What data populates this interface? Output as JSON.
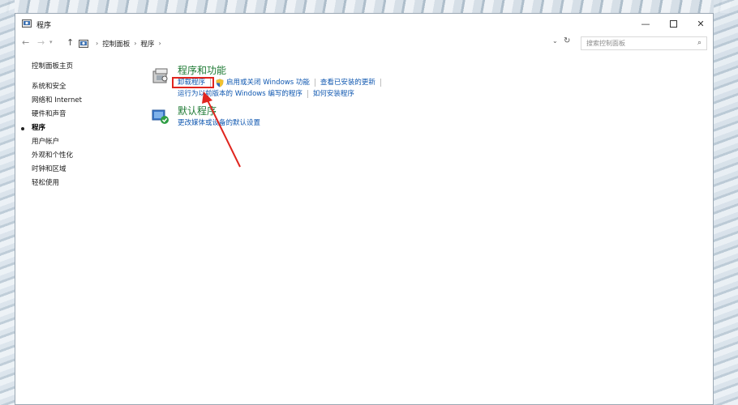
{
  "window": {
    "title": "程序",
    "controls": {
      "minimize": "—",
      "maximize": "",
      "close": "✕"
    }
  },
  "addressbar": {
    "crumbs": [
      "控制面板",
      "程序"
    ],
    "search_placeholder": "搜索控制面板"
  },
  "sidebar": {
    "home": "控制面板主页",
    "items": [
      {
        "label": "系统和安全"
      },
      {
        "label": "网络和 Internet"
      },
      {
        "label": "硬件和声音"
      },
      {
        "label": "程序",
        "current": true
      },
      {
        "label": "用户帐户"
      },
      {
        "label": "外观和个性化"
      },
      {
        "label": "时钟和区域"
      },
      {
        "label": "轻松使用"
      }
    ]
  },
  "sections": [
    {
      "title": "程序和功能",
      "icon": "programs-features-icon",
      "links_row1": [
        "卸载程序",
        "启用或关闭 Windows 功能",
        "查看已安装的更新"
      ],
      "links_row2": [
        "运行为以前版本的 Windows 编写的程序",
        "如何安装程序"
      ]
    },
    {
      "title": "默认程序",
      "icon": "default-programs-icon",
      "links_row1": [
        "更改媒体或设备的默认设置"
      ]
    }
  ],
  "colors": {
    "link": "#0f57b0",
    "section_title": "#1e7a34",
    "annotation": "#e0261f"
  }
}
